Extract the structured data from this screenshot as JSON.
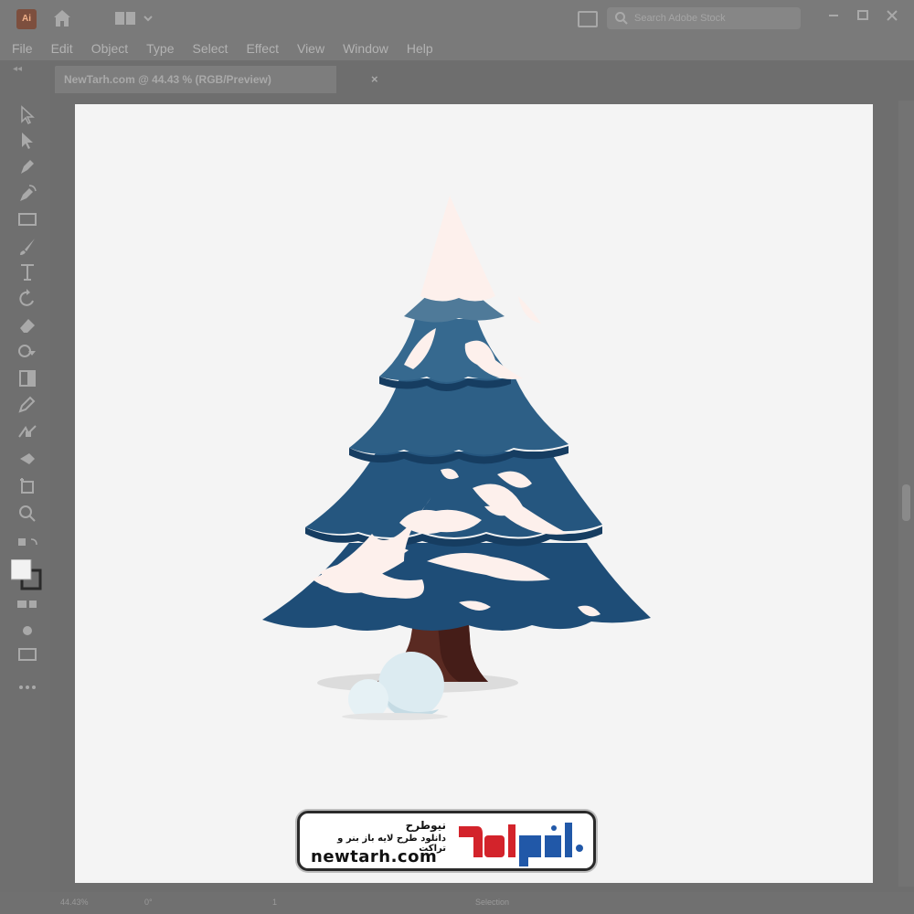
{
  "window": {
    "app_logo": "Ai",
    "search_placeholder": "Search Adobe Stock"
  },
  "menu": [
    "File",
    "Edit",
    "Object",
    "Type",
    "Select",
    "Effect",
    "View",
    "Window",
    "Help"
  ],
  "document_tab": {
    "title": "NewTarh.com @ 44.43 % (RGB/Preview)",
    "close": "×"
  },
  "icons": {
    "home": "home-icon",
    "workspace": "workspace-switcher-icon",
    "tools": [
      "selection-tool-icon",
      "direct-selection-tool-icon",
      "pen-tool-icon",
      "curvature-tool-icon",
      "rectangle-tool-icon",
      "paintbrush-tool-icon",
      "type-tool-icon",
      "rotate-tool-icon",
      "eraser-tool-icon",
      "shape-builder-tool-icon",
      "gradient-tool-icon",
      "eyedropper-tool-icon",
      "blend-tool-icon",
      "symbol-sprayer-tool-icon",
      "artboard-tool-icon",
      "zoom-tool-icon"
    ]
  },
  "statusbar": {
    "zoom": "44.43%",
    "rotation": "0°",
    "artboard_number": "1",
    "mode": "Selection"
  },
  "watermark": {
    "fa_title": "نیوطرح",
    "fa_subtitle": "دانلود طرح لایه باز بنر و تراکت",
    "domain": "newtarh.com",
    "logo_text": "نیوطرح"
  },
  "colors": {
    "tree_dark": "#1e4d77",
    "tree_mid": "#2d5f86",
    "tree_light": "#4f7a99",
    "snow": "#fdf0ec",
    "trunk": "#5a2a22",
    "snowball": "#dcebf1",
    "logo_red": "#d3232b",
    "logo_blue": "#2158a8"
  }
}
